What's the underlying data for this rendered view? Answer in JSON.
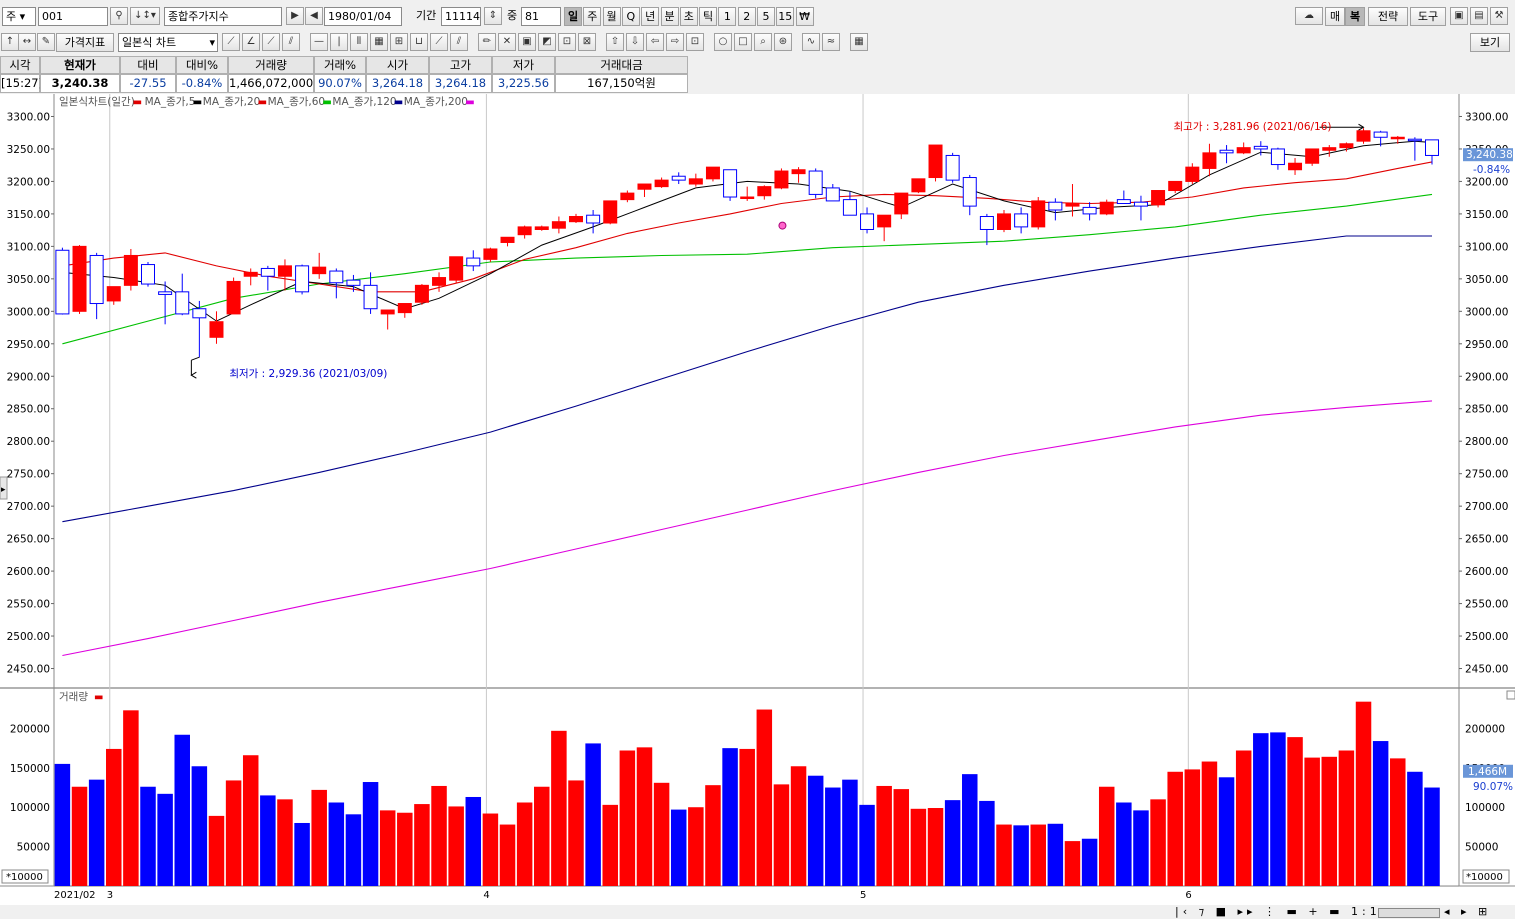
{
  "toolbar1": {
    "market_label": "주",
    "code": "001",
    "name": "종합주가지수",
    "date": "1980/01/04",
    "period_label": "기간",
    "period_value": "11114",
    "count_label": "중",
    "count_value": "81",
    "period_buttons": [
      "일",
      "주",
      "월",
      "Q",
      "년",
      "분",
      "초",
      "틱",
      "1",
      "2",
      "5",
      "15",
      "₩"
    ],
    "active_period": "일",
    "right_buttons": [
      "매",
      "복",
      "전략",
      "도구"
    ]
  },
  "toolbar2": {
    "indicator_label": "가격지표",
    "chart_type": "일본식 차트",
    "view_label": "보기"
  },
  "quote": {
    "headers": [
      "시각",
      "현재가",
      "대비",
      "대비%",
      "거래량",
      "거래%",
      "시가",
      "고가",
      "저가",
      "거래대금"
    ],
    "values": [
      "[15:27]",
      "3,240.38",
      "-27.55",
      "-0.84%",
      "1,466,072,000",
      "90.07%",
      "3,264.18",
      "3,264.18",
      "3,225.56",
      "167,150억원"
    ]
  },
  "colors": {
    "up": "#ff0000",
    "down": "#0000ff",
    "ma5": "#000000",
    "ma20": "#e00000",
    "ma60": "#00c000",
    "ma120": "#00008b",
    "ma200": "#dd00dd"
  },
  "chart_data": [
    {
      "type": "candlestick",
      "title": "일본식차트(일간)",
      "legend": [
        "MA_종가,5",
        "MA_종가,20",
        "MA_종가,60",
        "MA_종가,120",
        "MA_종가,200"
      ],
      "ylim": [
        2420,
        3330
      ],
      "yticks": [
        "3300.00",
        "3250.00",
        "3200.00",
        "3150.00",
        "3100.00",
        "3050.00",
        "3000.00",
        "2950.00",
        "2900.00",
        "2850.00",
        "2800.00",
        "2750.00",
        "2700.00",
        "2650.00",
        "2600.00",
        "2550.00",
        "2500.00",
        "2450.00"
      ],
      "xlabels": [
        {
          "i": 0,
          "t": "2021/02"
        },
        {
          "i": 3,
          "t": "3"
        },
        {
          "i": 25,
          "t": "4"
        },
        {
          "i": 47,
          "t": "5"
        },
        {
          "i": 66,
          "t": "6"
        }
      ],
      "ohlc": [
        [
          3094,
          3098,
          2995,
          2996
        ],
        [
          3000,
          3102,
          2996,
          3100
        ],
        [
          3086,
          3090,
          2988,
          3012
        ],
        [
          3016,
          3038,
          3010,
          3038
        ],
        [
          3040,
          3096,
          3032,
          3086
        ],
        [
          3072,
          3076,
          3038,
          3042
        ],
        [
          3030,
          3046,
          2980,
          3026
        ],
        [
          3030,
          3058,
          2994,
          2996
        ],
        [
          3004,
          3016,
          2929,
          2990
        ],
        [
          2960,
          3000,
          2950,
          2984
        ],
        [
          2996,
          3052,
          2996,
          3046
        ],
        [
          3054,
          3066,
          3040,
          3060
        ],
        [
          3066,
          3070,
          3032,
          3054
        ],
        [
          3054,
          3080,
          3032,
          3070
        ],
        [
          3070,
          3072,
          3026,
          3030
        ],
        [
          3058,
          3090,
          3050,
          3068
        ],
        [
          3062,
          3066,
          3020,
          3044
        ],
        [
          3048,
          3056,
          3030,
          3040
        ],
        [
          3040,
          3060,
          2996,
          3004
        ],
        [
          2996,
          3000,
          2972,
          3002
        ],
        [
          2998,
          3012,
          2990,
          3012
        ],
        [
          3014,
          3042,
          3010,
          3040
        ],
        [
          3040,
          3060,
          3030,
          3052
        ],
        [
          3048,
          3080,
          3044,
          3084
        ],
        [
          3082,
          3094,
          3062,
          3070
        ],
        [
          3080,
          3098,
          3076,
          3096
        ],
        [
          3106,
          3112,
          3100,
          3114
        ],
        [
          3118,
          3132,
          3112,
          3130
        ],
        [
          3126,
          3132,
          3124,
          3130
        ],
        [
          3128,
          3146,
          3120,
          3138
        ],
        [
          3138,
          3150,
          3136,
          3146
        ],
        [
          3148,
          3156,
          3120,
          3136
        ],
        [
          3136,
          3170,
          3134,
          3170
        ],
        [
          3172,
          3186,
          3168,
          3182
        ],
        [
          3188,
          3196,
          3176,
          3196
        ],
        [
          3192,
          3206,
          3190,
          3202
        ],
        [
          3208,
          3214,
          3196,
          3202
        ],
        [
          3196,
          3212,
          3192,
          3204
        ],
        [
          3204,
          3222,
          3200,
          3222
        ],
        [
          3218,
          3218,
          3170,
          3176
        ],
        [
          3176,
          3192,
          3170,
          3176
        ],
        [
          3178,
          3194,
          3172,
          3192
        ],
        [
          3190,
          3220,
          3188,
          3216
        ],
        [
          3212,
          3222,
          3198,
          3218
        ],
        [
          3216,
          3220,
          3174,
          3180
        ],
        [
          3190,
          3196,
          3172,
          3170
        ],
        [
          3172,
          3184,
          3160,
          3148
        ],
        [
          3150,
          3160,
          3120,
          3126
        ],
        [
          3130,
          3148,
          3108,
          3148
        ],
        [
          3150,
          3182,
          3142,
          3182
        ],
        [
          3184,
          3204,
          3182,
          3204
        ],
        [
          3206,
          3256,
          3200,
          3256
        ],
        [
          3240,
          3244,
          3198,
          3202
        ],
        [
          3206,
          3210,
          3148,
          3162
        ],
        [
          3146,
          3150,
          3102,
          3126
        ],
        [
          3126,
          3156,
          3122,
          3150
        ],
        [
          3150,
          3160,
          3120,
          3130
        ],
        [
          3130,
          3176,
          3126,
          3170
        ],
        [
          3168,
          3174,
          3140,
          3156
        ],
        [
          3162,
          3196,
          3146,
          3166
        ],
        [
          3160,
          3168,
          3140,
          3150
        ],
        [
          3150,
          3172,
          3148,
          3168
        ],
        [
          3172,
          3186,
          3166,
          3166
        ],
        [
          3168,
          3178,
          3140,
          3162
        ],
        [
          3164,
          3176,
          3160,
          3186
        ],
        [
          3186,
          3194,
          3182,
          3200
        ],
        [
          3200,
          3228,
          3196,
          3222
        ],
        [
          3220,
          3258,
          3208,
          3244
        ],
        [
          3248,
          3256,
          3228,
          3244
        ],
        [
          3244,
          3260,
          3242,
          3252
        ],
        [
          3254,
          3262,
          3240,
          3250
        ],
        [
          3250,
          3252,
          3218,
          3226
        ],
        [
          3218,
          3236,
          3210,
          3228
        ],
        [
          3228,
          3250,
          3224,
          3250
        ],
        [
          3248,
          3256,
          3238,
          3252
        ],
        [
          3252,
          3260,
          3246,
          3258
        ],
        [
          3262,
          3282,
          3258,
          3278
        ],
        [
          3276,
          3278,
          3254,
          3268
        ],
        [
          3266,
          3270,
          3258,
          3268
        ],
        [
          3265,
          3268,
          3232,
          3264
        ],
        [
          3264,
          3264,
          3226,
          3240
        ]
      ],
      "ma5": [
        [
          0,
          3060
        ],
        [
          3,
          3052
        ],
        [
          6,
          3040
        ],
        [
          9,
          2985
        ],
        [
          11,
          3010
        ],
        [
          14,
          3046
        ],
        [
          17,
          3038
        ],
        [
          20,
          3004
        ],
        [
          22,
          3020
        ],
        [
          25,
          3058
        ],
        [
          28,
          3102
        ],
        [
          31,
          3130
        ],
        [
          34,
          3160
        ],
        [
          37,
          3190
        ],
        [
          40,
          3200
        ],
        [
          43,
          3196
        ],
        [
          46,
          3185
        ],
        [
          49,
          3160
        ],
        [
          52,
          3196
        ],
        [
          55,
          3170
        ],
        [
          58,
          3152
        ],
        [
          61,
          3160
        ],
        [
          64,
          3164
        ],
        [
          67,
          3210
        ],
        [
          70,
          3245
        ],
        [
          73,
          3238
        ],
        [
          76,
          3255
        ],
        [
          79,
          3262
        ],
        [
          80,
          3260
        ]
      ],
      "ma20": [
        [
          0,
          3070
        ],
        [
          3,
          3082
        ],
        [
          6,
          3090
        ],
        [
          9,
          3070
        ],
        [
          12,
          3054
        ],
        [
          15,
          3042
        ],
        [
          18,
          3030
        ],
        [
          21,
          3030
        ],
        [
          24,
          3050
        ],
        [
          27,
          3080
        ],
        [
          30,
          3098
        ],
        [
          33,
          3120
        ],
        [
          36,
          3136
        ],
        [
          39,
          3150
        ],
        [
          42,
          3166
        ],
        [
          45,
          3176
        ],
        [
          48,
          3180
        ],
        [
          51,
          3178
        ],
        [
          54,
          3174
        ],
        [
          57,
          3168
        ],
        [
          60,
          3166
        ],
        [
          63,
          3168
        ],
        [
          66,
          3176
        ],
        [
          69,
          3190
        ],
        [
          72,
          3198
        ],
        [
          75,
          3204
        ],
        [
          78,
          3220
        ],
        [
          80,
          3230
        ]
      ],
      "ma60": [
        [
          0,
          2950
        ],
        [
          5,
          2985
        ],
        [
          10,
          3020
        ],
        [
          15,
          3042
        ],
        [
          20,
          3058
        ],
        [
          25,
          3076
        ],
        [
          30,
          3082
        ],
        [
          35,
          3086
        ],
        [
          40,
          3088
        ],
        [
          45,
          3098
        ],
        [
          50,
          3103
        ],
        [
          55,
          3108
        ],
        [
          60,
          3118
        ],
        [
          65,
          3130
        ],
        [
          70,
          3148
        ],
        [
          75,
          3162
        ],
        [
          80,
          3180
        ]
      ],
      "ma120": [
        [
          0,
          2676
        ],
        [
          5,
          2700
        ],
        [
          10,
          2724
        ],
        [
          15,
          2752
        ],
        [
          20,
          2782
        ],
        [
          25,
          2814
        ],
        [
          30,
          2854
        ],
        [
          35,
          2896
        ],
        [
          40,
          2938
        ],
        [
          45,
          2978
        ],
        [
          50,
          3014
        ],
        [
          55,
          3040
        ],
        [
          60,
          3062
        ],
        [
          65,
          3082
        ],
        [
          70,
          3100
        ],
        [
          75,
          3116
        ],
        [
          80,
          3116
        ]
      ],
      "ma200": [
        [
          0,
          2470
        ],
        [
          5,
          2496
        ],
        [
          10,
          2524
        ],
        [
          15,
          2552
        ],
        [
          20,
          2578
        ],
        [
          25,
          2604
        ],
        [
          30,
          2634
        ],
        [
          35,
          2664
        ],
        [
          40,
          2694
        ],
        [
          45,
          2724
        ],
        [
          50,
          2752
        ],
        [
          55,
          2778
        ],
        [
          60,
          2800
        ],
        [
          65,
          2822
        ],
        [
          70,
          2840
        ],
        [
          75,
          2852
        ],
        [
          80,
          2862
        ]
      ],
      "annotations": [
        {
          "text": "최고가 : 3,281.96 (2021/06/16)",
          "color": "#e00000",
          "index": 76,
          "value": 3281.96
        },
        {
          "text": "최저가 : 2,929.36 (2021/03/09)",
          "color": "#0000cc",
          "index": 8,
          "value": 2929.36
        }
      ],
      "current_price_label": "3,240.38",
      "current_change_label": "-0.84%"
    },
    {
      "type": "bar",
      "title": "거래량",
      "ylim": [
        0,
        245000
      ],
      "yticks": [
        "200000",
        "150000",
        "100000",
        "50000"
      ],
      "unit_label": "*10000",
      "current_volume_label": "1,466M",
      "current_ratio_label": "90.07%",
      "values": [
        155000,
        126000,
        135000,
        174000,
        223000,
        126000,
        117000,
        192000,
        152000,
        89000,
        134000,
        166000,
        115000,
        110000,
        80000,
        122000,
        106000,
        91000,
        132000,
        96000,
        93000,
        104000,
        127000,
        101000,
        113000,
        92000,
        78000,
        106000,
        126000,
        197000,
        134000,
        181000,
        103000,
        172000,
        176000,
        131000,
        97000,
        100000,
        128000,
        175000,
        174000,
        224000,
        129000,
        152000,
        140000,
        125000,
        135000,
        103000,
        127000,
        123000,
        98000,
        99000,
        109000,
        142000,
        108000,
        78000,
        77000,
        78000,
        79000,
        57000,
        60000,
        126000,
        106000,
        96000,
        110000,
        145000,
        148000,
        158000,
        138000,
        172000,
        194000,
        195000,
        189000,
        163000,
        164000,
        172000,
        234000,
        184000,
        162000,
        145000,
        125000
      ]
    }
  ]
}
